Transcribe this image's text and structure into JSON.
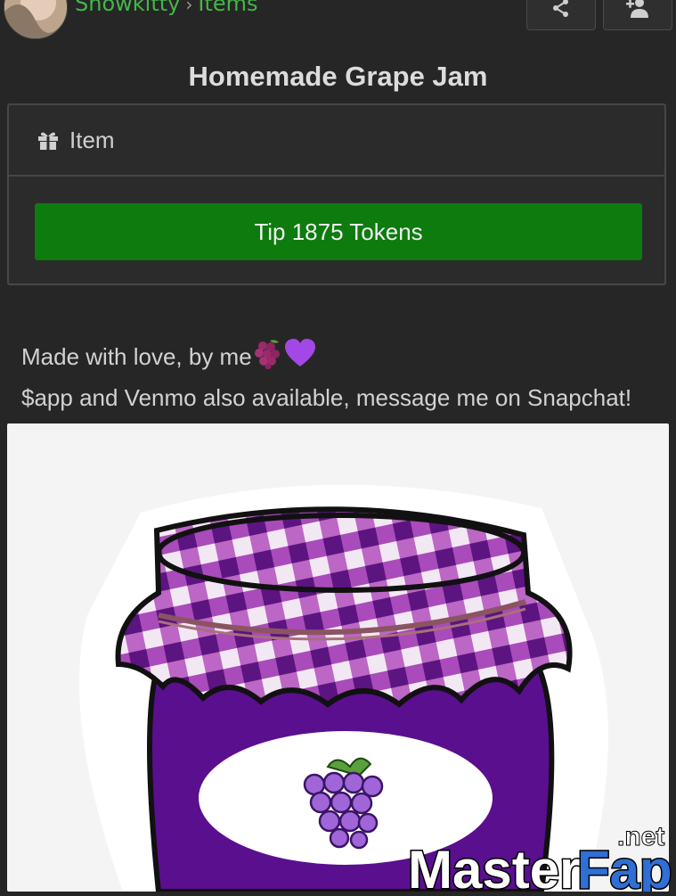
{
  "header": {
    "breadcrumb": {
      "user": "Snowkitty",
      "separator": "›",
      "section": "Items"
    },
    "share_icon": "share-icon",
    "follow_icon": "add-user-icon"
  },
  "title": "Homemade Grape Jam",
  "item_card": {
    "type_icon": "gift-icon",
    "type_label": "Item",
    "tip_button": "Tip 1875 Tokens"
  },
  "description": {
    "line1": "Made with love, by me",
    "line2": "$app and Venmo also available, message me on Snapchat!"
  },
  "colors": {
    "accent_green": "#43b649",
    "button_green": "#0d7b0e",
    "background": "#262626",
    "jam_purple": "#5a0f8f"
  },
  "watermark": {
    "brand": "MasterFap",
    "tld": ".net"
  }
}
